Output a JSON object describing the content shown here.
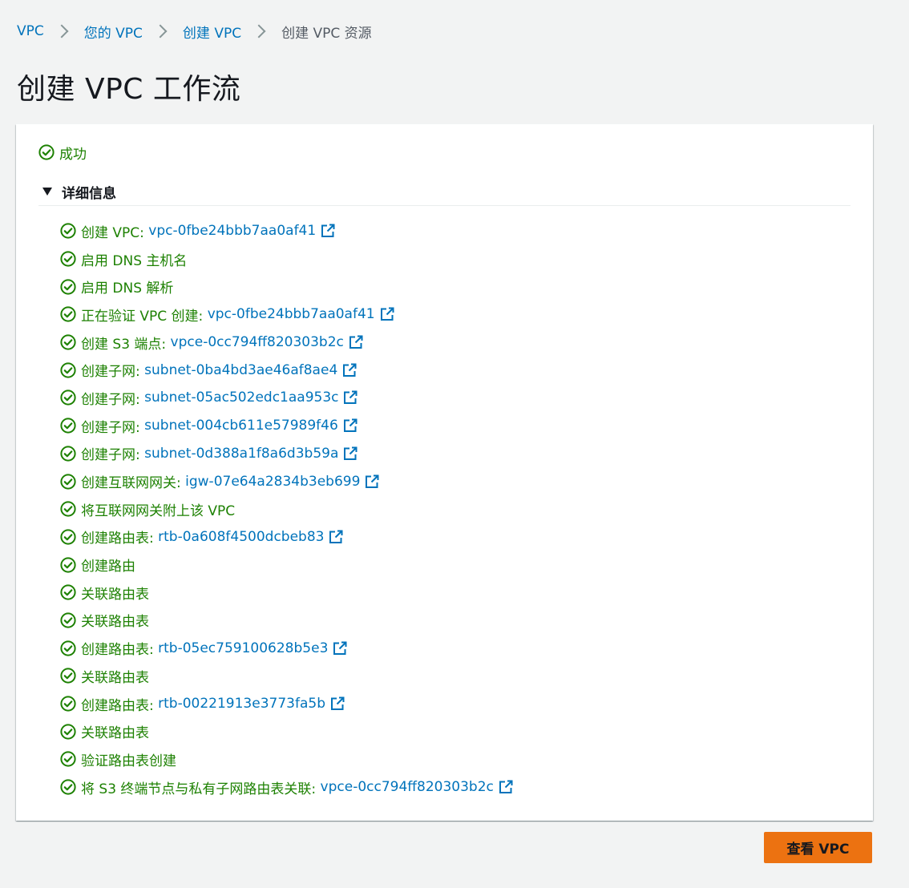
{
  "breadcrumb": {
    "items": [
      {
        "label": "VPC",
        "link": true
      },
      {
        "label": "您的 VPC",
        "link": true
      },
      {
        "label": "创建 VPC",
        "link": true
      },
      {
        "label": "创建 VPC 资源",
        "link": false
      }
    ]
  },
  "page_title": "创建 VPC 工作流",
  "status": {
    "label": "成功",
    "color": "#1d8102",
    "icon": "check-circle-icon"
  },
  "details": {
    "label": "详细信息",
    "expanded": true,
    "steps": [
      {
        "text": "创建 VPC: ",
        "link": "vpc-0fbe24bbb7aa0af41"
      },
      {
        "text": "启用 DNS 主机名",
        "link": null
      },
      {
        "text": "启用 DNS 解析",
        "link": null
      },
      {
        "text": "正在验证 VPC 创建: ",
        "link": "vpc-0fbe24bbb7aa0af41"
      },
      {
        "text": "创建 S3 端点: ",
        "link": "vpce-0cc794ff820303b2c"
      },
      {
        "text": "创建子网: ",
        "link": "subnet-0ba4bd3ae46af8ae4"
      },
      {
        "text": "创建子网: ",
        "link": "subnet-05ac502edc1aa953c"
      },
      {
        "text": "创建子网: ",
        "link": "subnet-004cb611e57989f46"
      },
      {
        "text": "创建子网: ",
        "link": "subnet-0d388a1f8a6d3b59a"
      },
      {
        "text": "创建互联网网关: ",
        "link": "igw-07e64a2834b3eb699"
      },
      {
        "text": "将互联网网关附上该 VPC",
        "link": null
      },
      {
        "text": "创建路由表: ",
        "link": "rtb-0a608f4500dcbeb83"
      },
      {
        "text": "创建路由",
        "link": null
      },
      {
        "text": "关联路由表",
        "link": null
      },
      {
        "text": "关联路由表",
        "link": null
      },
      {
        "text": "创建路由表: ",
        "link": "rtb-05ec759100628b5e3"
      },
      {
        "text": "关联路由表",
        "link": null
      },
      {
        "text": "创建路由表: ",
        "link": "rtb-00221913e3773fa5b"
      },
      {
        "text": "关联路由表",
        "link": null
      },
      {
        "text": "验证路由表创建",
        "link": null
      },
      {
        "text": "将 S3 终端节点与私有子网路由表关联: ",
        "link": "vpce-0cc794ff820303b2c"
      }
    ]
  },
  "primary_button": {
    "label": "查看 VPC",
    "color": "#ec7211"
  },
  "colors": {
    "link": "#0073bb",
    "success": "#1d8102",
    "background": "#f2f3f3"
  }
}
